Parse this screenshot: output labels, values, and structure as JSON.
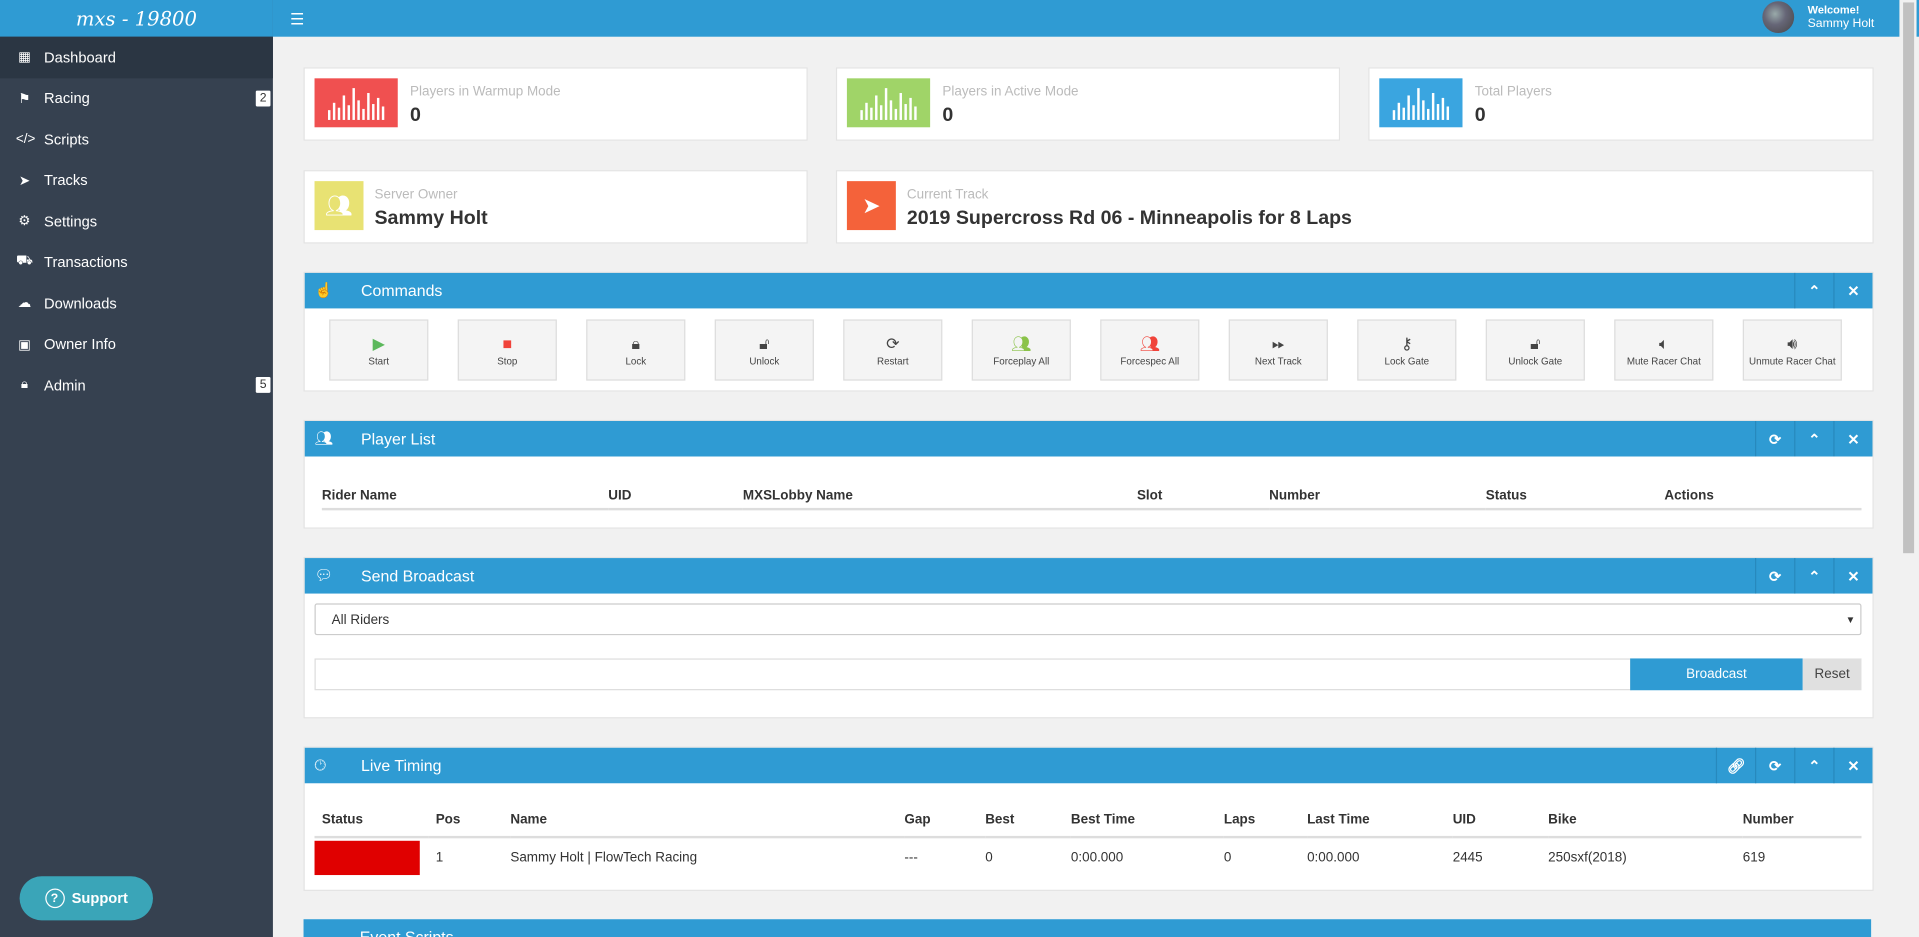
{
  "app": {
    "brand": "mxs - 19800",
    "welcome_label": "Welcome!",
    "user_name": "Sammy Holt"
  },
  "sidebar": {
    "items": [
      {
        "label": "Dashboard",
        "icon": "dashboard-icon",
        "badge": ""
      },
      {
        "label": "Racing",
        "icon": "flag-icon",
        "badge": "2"
      },
      {
        "label": "Scripts",
        "icon": "code-icon",
        "badge": ""
      },
      {
        "label": "Tracks",
        "icon": "location-arrow-icon",
        "badge": ""
      },
      {
        "label": "Settings",
        "icon": "gear-icon",
        "badge": ""
      },
      {
        "label": "Transactions",
        "icon": "cart-icon",
        "badge": ""
      },
      {
        "label": "Downloads",
        "icon": "cloud-download-icon",
        "badge": ""
      },
      {
        "label": "Owner Info",
        "icon": "briefcase-icon",
        "badge": ""
      },
      {
        "label": "Admin",
        "icon": "lock-icon",
        "badge": "5"
      }
    ],
    "support_label": "Support"
  },
  "stats": {
    "warmup": {
      "label": "Players in Warmup Mode",
      "value": "0",
      "color": "#f05050"
    },
    "active": {
      "label": "Players in Active Mode",
      "value": "0",
      "color": "#a0d468"
    },
    "total": {
      "label": "Total Players",
      "value": "0",
      "color": "#3aa5e0"
    },
    "owner": {
      "label": "Server Owner",
      "value": "Sammy Holt",
      "color": "#e8e273"
    },
    "track": {
      "label": "Current Track",
      "value": "2019 Supercross Rd 06 - Minneapolis for 8 Laps",
      "color": "#f4623a"
    }
  },
  "commands": {
    "title": "Commands",
    "buttons": [
      {
        "label": "Start",
        "icon": "play-icon"
      },
      {
        "label": "Stop",
        "icon": "stop-icon"
      },
      {
        "label": "Lock",
        "icon": "lock-icon"
      },
      {
        "label": "Unlock",
        "icon": "unlock-icon"
      },
      {
        "label": "Restart",
        "icon": "refresh-icon"
      },
      {
        "label": "Forceplay All",
        "icon": "users-icon"
      },
      {
        "label": "Forcespec All",
        "icon": "users-icon"
      },
      {
        "label": "Next Track",
        "icon": "fast-forward-icon"
      },
      {
        "label": "Lock Gate",
        "icon": "key-icon"
      },
      {
        "label": "Unlock Gate",
        "icon": "unlock-icon"
      },
      {
        "label": "Mute Racer Chat",
        "icon": "volume-off-icon"
      },
      {
        "label": "Unmute Racer Chat",
        "icon": "volume-up-icon"
      }
    ]
  },
  "player_list": {
    "title": "Player List",
    "columns": [
      "Rider Name",
      "UID",
      "MXSLobby Name",
      "Slot",
      "Number",
      "Status",
      "Actions"
    ]
  },
  "broadcast": {
    "title": "Send Broadcast",
    "target": "All Riders",
    "send_label": "Broadcast",
    "reset_label": "Reset"
  },
  "live_timing": {
    "title": "Live Timing",
    "columns": [
      "Status",
      "Pos",
      "Name",
      "Gap",
      "Best",
      "Best Time",
      "Laps",
      "Last Time",
      "UID",
      "Bike",
      "Number"
    ],
    "rows": [
      {
        "status_color": "#e00000",
        "pos": "1",
        "name": "Sammy Holt | FlowTech Racing",
        "gap": "---",
        "best": "0",
        "best_time": "0:00.000",
        "laps": "0",
        "last_time": "0:00.000",
        "uid": "2445",
        "bike": "250sxf(2018)",
        "number": "619"
      }
    ]
  },
  "next_panel": {
    "title": "Event Scripts"
  }
}
